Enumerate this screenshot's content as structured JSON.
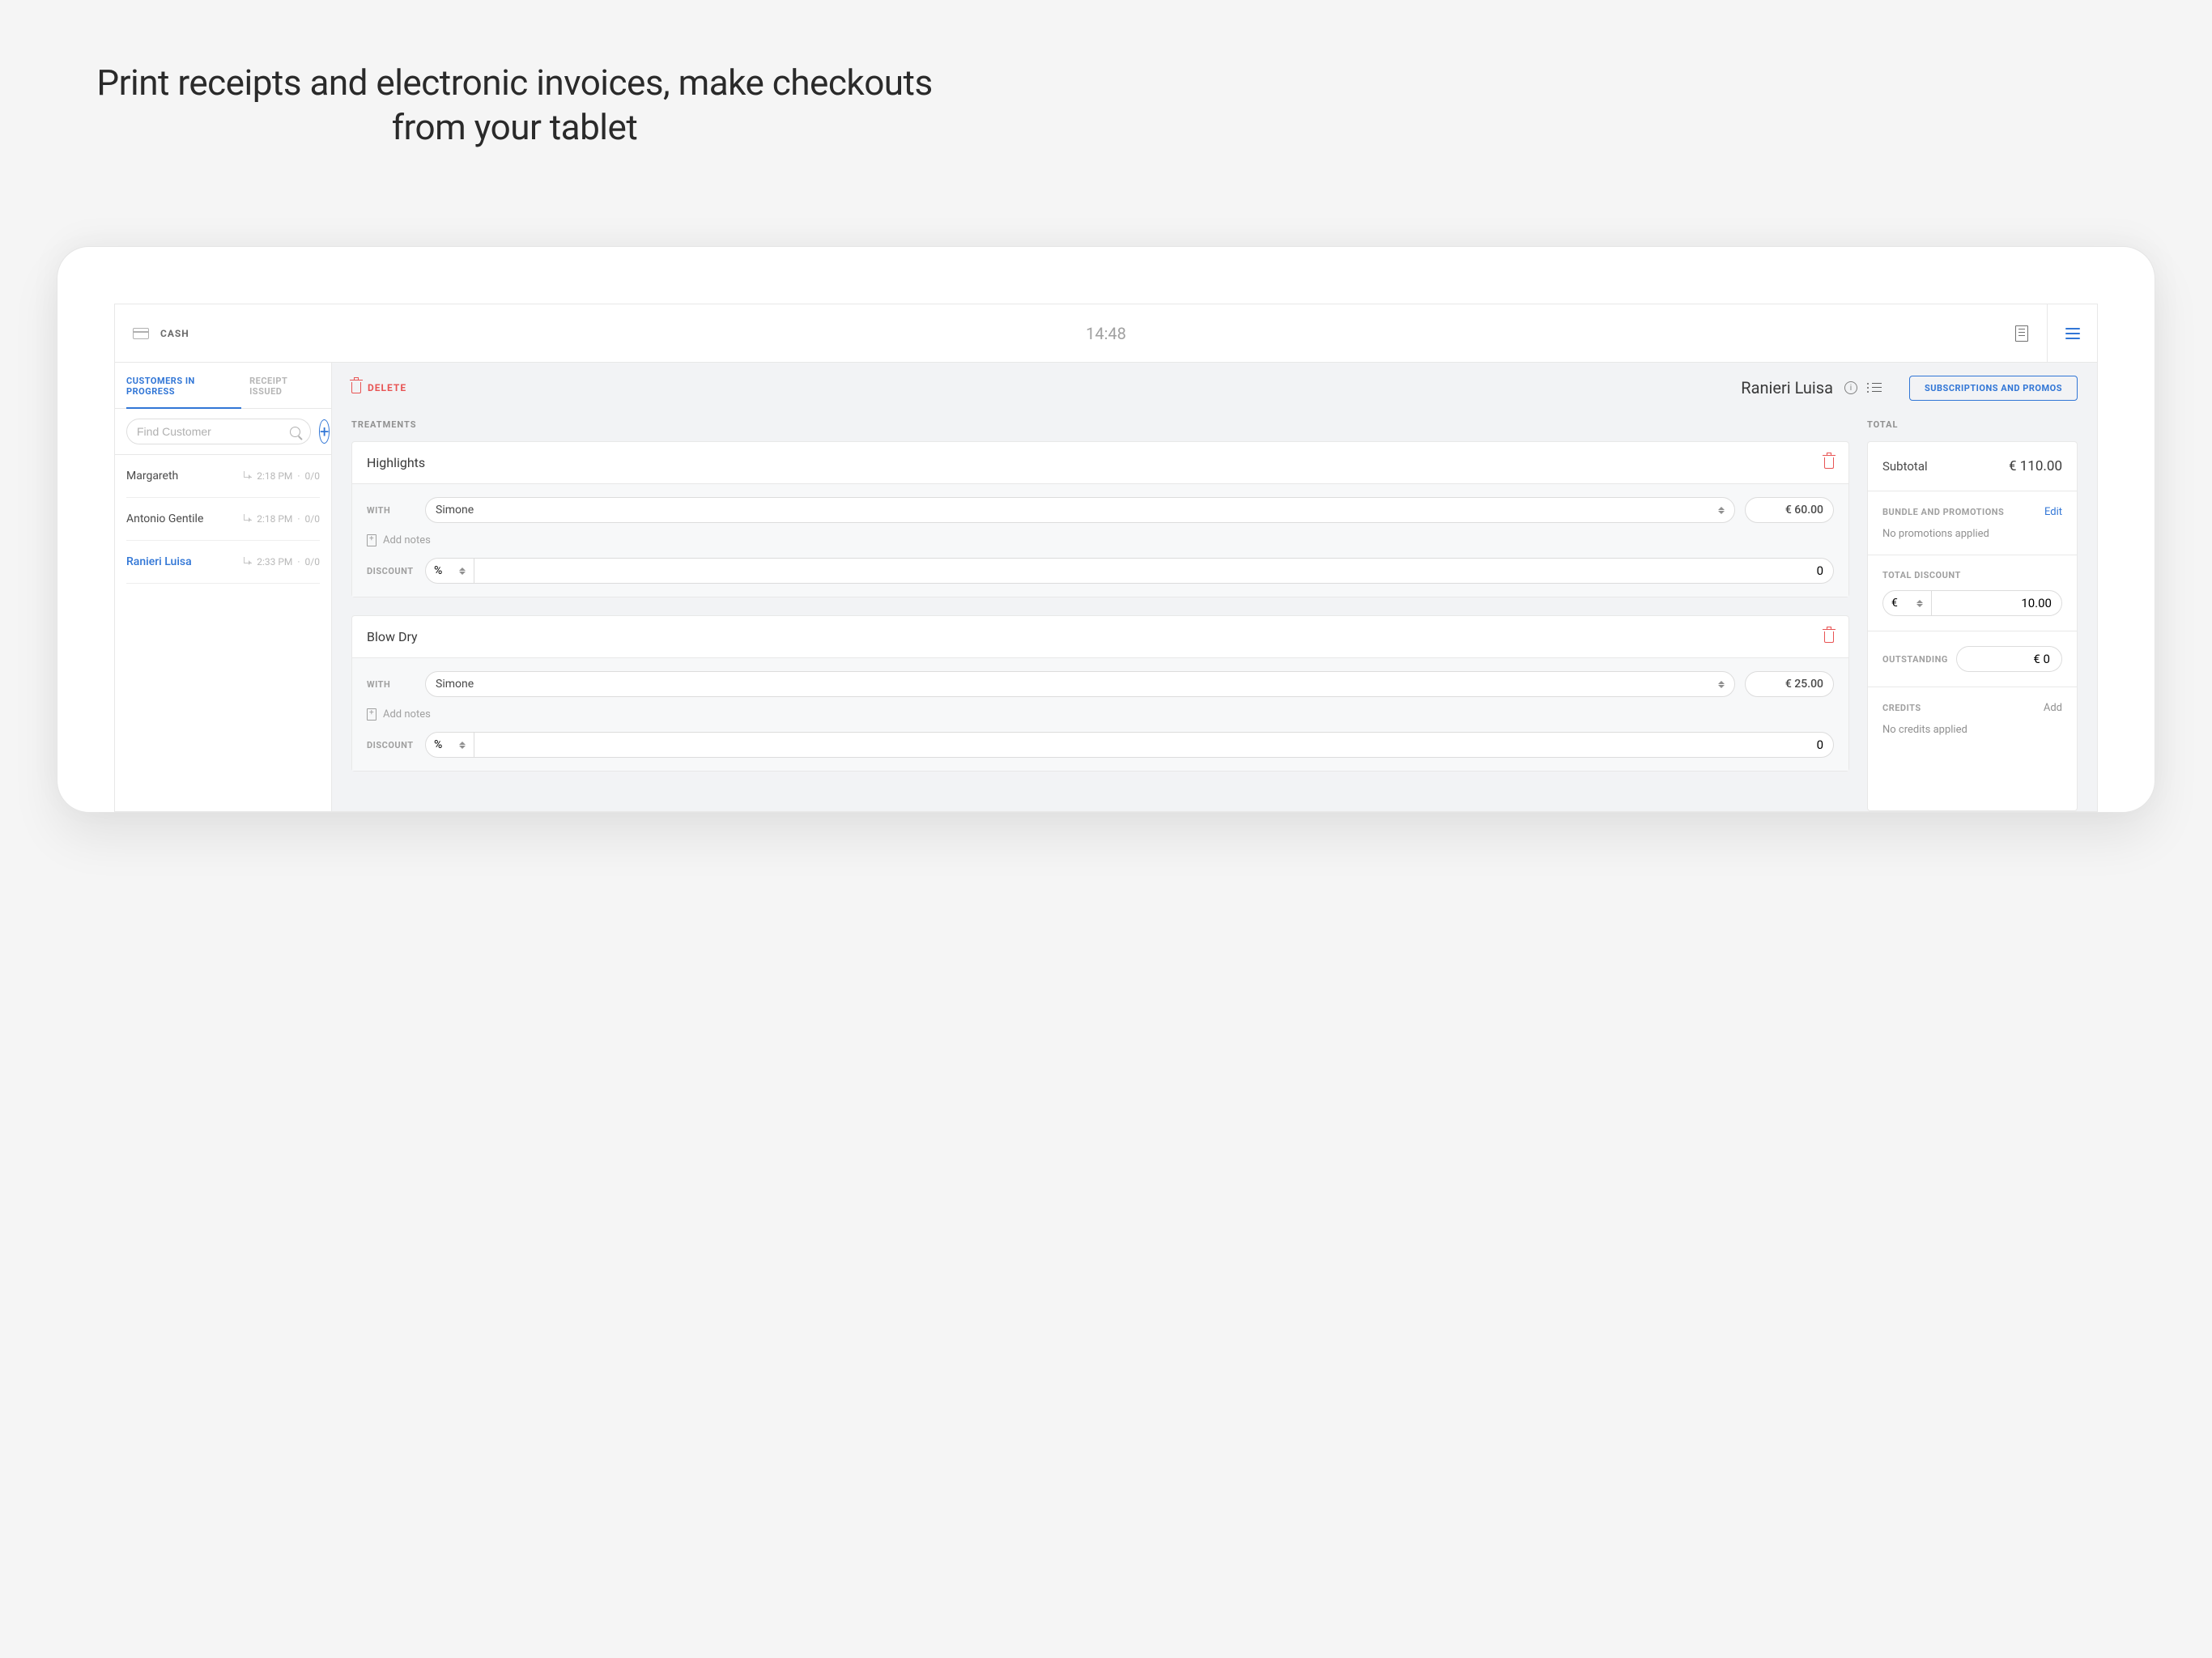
{
  "hero": "Print receipts and electronic invoices, make checkouts from your tablet",
  "topbar": {
    "cash": "CASH",
    "time": "14:48"
  },
  "sidebar": {
    "tabs": {
      "progress": "CUSTOMERS IN PROGRESS",
      "issued": "RECEIPT ISSUED"
    },
    "search_placeholder": "Find Customer",
    "customers": [
      {
        "name": "Margareth",
        "time": "2:18 PM",
        "count": "0/0"
      },
      {
        "name": "Antonio Gentile",
        "time": "2:18 PM",
        "count": "0/0"
      },
      {
        "name": "Ranieri Luisa",
        "time": "2:33 PM",
        "count": "0/0"
      }
    ]
  },
  "main": {
    "delete": "DELETE",
    "customer": "Ranieri Luisa",
    "subs_btn": "SUBSCRIPTIONS AND PROMOS",
    "treatments_label": "TREATMENTS",
    "with_label": "WITH",
    "notes_label": "Add notes",
    "discount_label": "DISCOUNT",
    "discount_type": "%",
    "treatments": [
      {
        "name": "Highlights",
        "with": "Simone",
        "price": "€ 60.00",
        "discount": "0"
      },
      {
        "name": "Blow Dry",
        "with": "Simone",
        "price": "€ 25.00",
        "discount": "0"
      }
    ]
  },
  "totals": {
    "label": "TOTAL",
    "subtotal_label": "Subtotal",
    "subtotal_value": "€ 110.00",
    "bundle_label": "BUNDLE AND PROMOTIONS",
    "bundle_edit": "Edit",
    "bundle_text": "No promotions applied",
    "total_discount_label": "TOTAL DISCOUNT",
    "total_discount_currency": "€",
    "total_discount_value": "10.00",
    "outstanding_label": "OUTSTANDING",
    "outstanding_value": "€ 0",
    "credits_label": "CREDITS",
    "credits_add": "Add",
    "credits_text": "No credits applied"
  }
}
